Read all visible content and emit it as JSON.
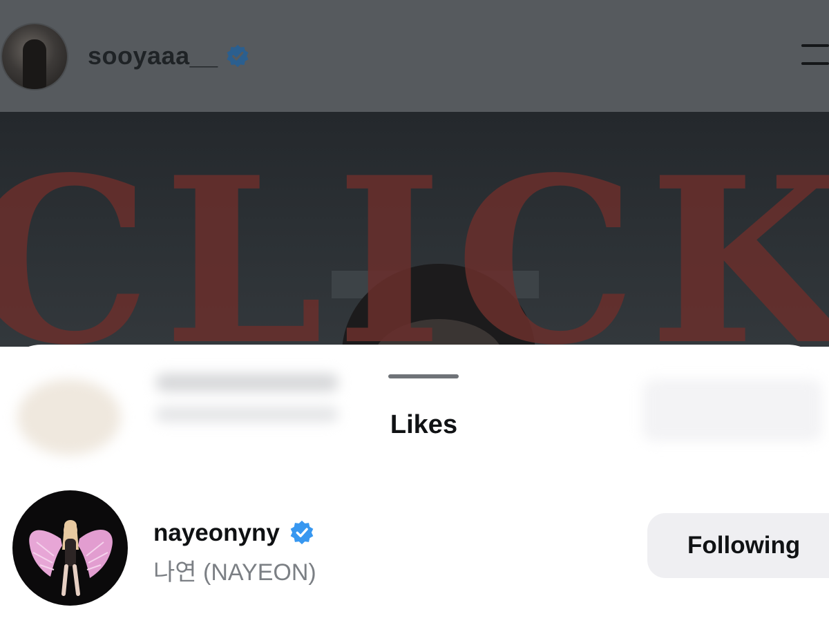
{
  "post_header": {
    "username": "sooyaaa__",
    "verified": true
  },
  "post_image": {
    "overlay_text": "CLICK",
    "text_color": "#6a2f2c"
  },
  "likes_sheet": {
    "title": "Likes",
    "users": [
      {
        "username": "nayeonyny",
        "verified": true,
        "full_name": "나연 (NAYEON)",
        "follow_button": "Following"
      }
    ]
  },
  "colors": {
    "verified_blue": "#3797f0",
    "verified_blue_dimmed": "#2b5f8f",
    "button_bg": "#efeff2",
    "secondary_text": "#7b7f84"
  }
}
